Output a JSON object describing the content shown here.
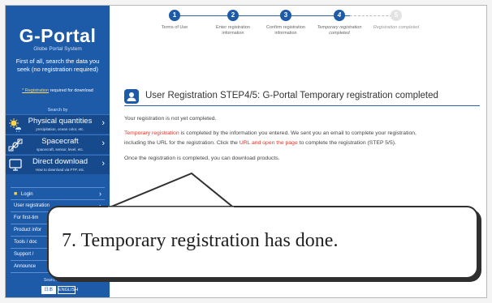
{
  "sidebar": {
    "logo": "G-Portal",
    "logo_sub": "Globe Portal System",
    "intro": "First of all, search the data you seek (no registration required)",
    "intro_note_highlight": "* Registration",
    "intro_note_rest": " required for download",
    "search_by": "Search by",
    "categories": [
      {
        "title": "Physical quantities",
        "subtitle": "precipitation, ocean color, etc.",
        "icon": "physical-quantities-icon"
      },
      {
        "title": "Spacecraft",
        "subtitle": "spacecraft, sensor, level, etc.",
        "icon": "spacecraft-icon"
      },
      {
        "title": "Direct download",
        "subtitle": "How to download via FTP, etc.",
        "icon": "direct-download-icon"
      }
    ],
    "menu": [
      {
        "label": "Login",
        "icon": "user-icon"
      },
      {
        "label": "User registration"
      },
      {
        "label": "For first-tim"
      },
      {
        "label": "Product infor"
      },
      {
        "label": "Tools / doc"
      },
      {
        "label": "Support / "
      },
      {
        "label": "Announce"
      }
    ],
    "search_site": "Search this site",
    "lang_jp": "日本語",
    "lang_en": "ENGLISH"
  },
  "steps": [
    {
      "num": "1",
      "label": "Terms of Use",
      "state": "done"
    },
    {
      "num": "2",
      "label": "Enter registration information",
      "state": "done"
    },
    {
      "num": "3",
      "label": "Confirm registration information",
      "state": "done"
    },
    {
      "num": "4",
      "label": "Temporary registration completed",
      "state": "current"
    },
    {
      "num": "5",
      "label": "Registration completed",
      "state": "inactive"
    }
  ],
  "main": {
    "title": "User Registration STEP4/5: G-Portal Temporary registration completed",
    "p1": "Your registration is not yet completed.",
    "p2_red1": "Temporary registration",
    "p2_a": " is completed by the information you entered. We sent you an email to complete your registration,",
    "p2_b": "including the URL for the registration. Click the ",
    "p2_red2": "URL and open the page",
    "p2_c": " to complete the registration (STEP 5/5).",
    "p3": "Once the registration is completed, you can download products."
  },
  "callout": {
    "text": "7. Temporary registration has done."
  },
  "colors": {
    "brand": "#1d5aa8",
    "highlight_red": "#d9382b"
  }
}
